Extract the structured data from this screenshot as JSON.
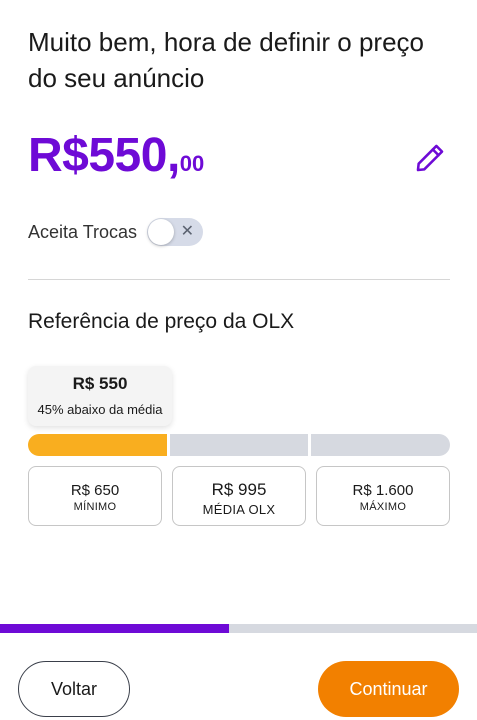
{
  "header": {
    "title": "Muito bem, hora de definir o preço do seu anúncio"
  },
  "price": {
    "main": "R$550,",
    "cents": "00"
  },
  "trade": {
    "label": "Aceita Trocas",
    "enabled": false
  },
  "reference": {
    "title": "Referência de preço da OLX",
    "tooltip_value": "R$ 550",
    "tooltip_note": "45% abaixo da média",
    "cards": [
      {
        "value": "R$ 650",
        "label": "MÍNIMO"
      },
      {
        "value": "R$ 995",
        "label": "MÉDIA OLX"
      },
      {
        "value": "R$ 1.600",
        "label": "MÁXIMO"
      }
    ]
  },
  "progress": {
    "fraction": 0.48
  },
  "footer": {
    "back_label": "Voltar",
    "next_label": "Continuar"
  },
  "colors": {
    "brand_purple": "#6e0ad6",
    "accent_orange": "#f28000",
    "bar_yellow": "#f9ae1f"
  },
  "icons": {
    "edit": "pencil-icon",
    "toggle_off": "close-icon"
  }
}
